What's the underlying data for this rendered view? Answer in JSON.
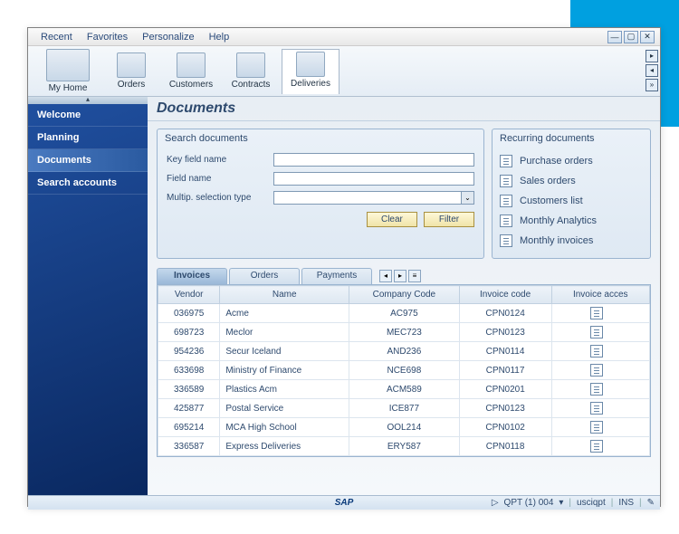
{
  "menu": {
    "recent": "Recent",
    "favorites": "Favorites",
    "personalize": "Personalize",
    "help": "Help"
  },
  "toolbar": {
    "items": [
      {
        "label": "My Home"
      },
      {
        "label": "Orders"
      },
      {
        "label": "Customers"
      },
      {
        "label": "Contracts"
      },
      {
        "label": "Deliveries"
      }
    ]
  },
  "sidebar": {
    "items": [
      {
        "label": "Welcome"
      },
      {
        "label": "Planning"
      },
      {
        "label": "Documents"
      },
      {
        "label": "Search accounts"
      }
    ]
  },
  "page": {
    "title": "Documents"
  },
  "search": {
    "title": "Search documents",
    "fields": {
      "key_field": "Key field name",
      "field_name": "Field name",
      "multi_sel": "Multip. selection type"
    },
    "buttons": {
      "clear": "Clear",
      "filter": "Filter"
    }
  },
  "recurring": {
    "title": "Recurring documents",
    "items": [
      "Purchase orders",
      "Sales orders",
      "Customers list",
      "Monthly Analytics",
      "Monthly invoices"
    ]
  },
  "tabs": {
    "items": [
      "Invoices",
      "Orders",
      "Payments"
    ]
  },
  "grid": {
    "headers": [
      "Vendor",
      "Name",
      "Company Code",
      "Invoice code",
      "Invoice acces"
    ],
    "rows": [
      {
        "vendor": "036975",
        "name": "Acme",
        "company": "AC975",
        "invoice": "CPN0124"
      },
      {
        "vendor": "698723",
        "name": "Meclor",
        "company": "MEC723",
        "invoice": "CPN0123"
      },
      {
        "vendor": "954236",
        "name": "Secur Iceland",
        "company": "AND236",
        "invoice": "CPN0114"
      },
      {
        "vendor": "633698",
        "name": "Ministry of Finance",
        "company": "NCE698",
        "invoice": "CPN0117"
      },
      {
        "vendor": "336589",
        "name": "Plastics Acm",
        "company": "ACM589",
        "invoice": "CPN0201"
      },
      {
        "vendor": "425877",
        "name": "Postal Service",
        "company": "ICE877",
        "invoice": "CPN0123"
      },
      {
        "vendor": "695214",
        "name": "MCA High School",
        "company": "OOL214",
        "invoice": "CPN0102"
      },
      {
        "vendor": "336587",
        "name": "Express Deliveries",
        "company": "ERY587",
        "invoice": "CPN0118"
      }
    ]
  },
  "status": {
    "logo": "SAP",
    "system": "QPT (1) 004",
    "user": "usciqpt",
    "mode": "INS"
  }
}
